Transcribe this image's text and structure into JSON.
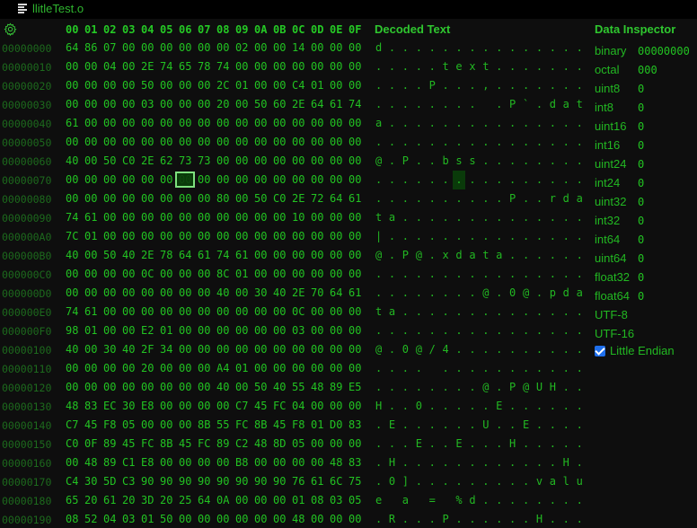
{
  "tab": {
    "title": "llitleTest.o",
    "icon": "hamburger-lines-icon"
  },
  "hex": {
    "column_headers": [
      "00",
      "01",
      "02",
      "03",
      "04",
      "05",
      "06",
      "07",
      "08",
      "09",
      "0A",
      "0B",
      "0C",
      "0D",
      "0E",
      "0F"
    ],
    "selected": {
      "row": 7,
      "col": 6
    },
    "rows": [
      {
        "address": "00000000",
        "bytes": [
          "64",
          "86",
          "07",
          "00",
          "00",
          "00",
          "00",
          "00",
          "00",
          "02",
          "00",
          "00",
          "14",
          "00",
          "00",
          "00"
        ],
        "text": "d..............."
      },
      {
        "address": "00000010",
        "bytes": [
          "00",
          "00",
          "04",
          "00",
          "2E",
          "74",
          "65",
          "78",
          "74",
          "00",
          "00",
          "00",
          "00",
          "00",
          "00",
          "00"
        ],
        "text": ".....text......."
      },
      {
        "address": "00000020",
        "bytes": [
          "00",
          "00",
          "00",
          "00",
          "50",
          "00",
          "00",
          "00",
          "2C",
          "01",
          "00",
          "00",
          "C4",
          "01",
          "00",
          "00"
        ],
        "text": "....P...,......."
      },
      {
        "address": "00000030",
        "bytes": [
          "00",
          "00",
          "00",
          "00",
          "03",
          "00",
          "00",
          "00",
          "20",
          "00",
          "50",
          "60",
          "2E",
          "64",
          "61",
          "74"
        ],
        "text": "........ .P`.dat"
      },
      {
        "address": "00000040",
        "bytes": [
          "61",
          "00",
          "00",
          "00",
          "00",
          "00",
          "00",
          "00",
          "00",
          "00",
          "00",
          "00",
          "00",
          "00",
          "00",
          "00"
        ],
        "text": "a..............."
      },
      {
        "address": "00000050",
        "bytes": [
          "00",
          "00",
          "00",
          "00",
          "00",
          "00",
          "00",
          "00",
          "00",
          "00",
          "00",
          "00",
          "00",
          "00",
          "00",
          "00"
        ],
        "text": "................"
      },
      {
        "address": "00000060",
        "bytes": [
          "40",
          "00",
          "50",
          "C0",
          "2E",
          "62",
          "73",
          "73",
          "00",
          "00",
          "00",
          "00",
          "00",
          "00",
          "00",
          "00"
        ],
        "text": "@.P..bss........"
      },
      {
        "address": "00000070",
        "bytes": [
          "00",
          "00",
          "00",
          "00",
          "00",
          "00",
          "00",
          "00",
          "00",
          "00",
          "00",
          "00",
          "00",
          "00",
          "00",
          "00"
        ],
        "text": "................"
      },
      {
        "address": "00000080",
        "bytes": [
          "00",
          "00",
          "00",
          "00",
          "00",
          "00",
          "00",
          "00",
          "80",
          "00",
          "50",
          "C0",
          "2E",
          "72",
          "64",
          "61"
        ],
        "text": "..........P..rda"
      },
      {
        "address": "00000090",
        "bytes": [
          "74",
          "61",
          "00",
          "00",
          "00",
          "00",
          "00",
          "00",
          "00",
          "00",
          "00",
          "00",
          "10",
          "00",
          "00",
          "00"
        ],
        "text": "ta.............."
      },
      {
        "address": "000000A0",
        "bytes": [
          "7C",
          "01",
          "00",
          "00",
          "00",
          "00",
          "00",
          "00",
          "00",
          "00",
          "00",
          "00",
          "00",
          "00",
          "00",
          "00"
        ],
        "text": "|..............."
      },
      {
        "address": "000000B0",
        "bytes": [
          "40",
          "00",
          "50",
          "40",
          "2E",
          "78",
          "64",
          "61",
          "74",
          "61",
          "00",
          "00",
          "00",
          "00",
          "00",
          "00"
        ],
        "text": "@.P@.xdata......"
      },
      {
        "address": "000000C0",
        "bytes": [
          "00",
          "00",
          "00",
          "00",
          "0C",
          "00",
          "00",
          "00",
          "8C",
          "01",
          "00",
          "00",
          "00",
          "00",
          "00",
          "00"
        ],
        "text": "................"
      },
      {
        "address": "000000D0",
        "bytes": [
          "00",
          "00",
          "00",
          "00",
          "00",
          "00",
          "00",
          "00",
          "40",
          "00",
          "30",
          "40",
          "2E",
          "70",
          "64",
          "61"
        ],
        "text": "........@.0@.pda"
      },
      {
        "address": "000000E0",
        "bytes": [
          "74",
          "61",
          "00",
          "00",
          "00",
          "00",
          "00",
          "00",
          "00",
          "00",
          "00",
          "00",
          "0C",
          "00",
          "00",
          "00"
        ],
        "text": "ta.............."
      },
      {
        "address": "000000F0",
        "bytes": [
          "98",
          "01",
          "00",
          "00",
          "E2",
          "01",
          "00",
          "00",
          "00",
          "00",
          "00",
          "00",
          "03",
          "00",
          "00",
          "00"
        ],
        "text": "................"
      },
      {
        "address": "00000100",
        "bytes": [
          "40",
          "00",
          "30",
          "40",
          "2F",
          "34",
          "00",
          "00",
          "00",
          "00",
          "00",
          "00",
          "00",
          "00",
          "00",
          "00"
        ],
        "text": "@.0@/4.........."
      },
      {
        "address": "00000110",
        "bytes": [
          "00",
          "00",
          "00",
          "00",
          "20",
          "00",
          "00",
          "00",
          "A4",
          "01",
          "00",
          "00",
          "00",
          "00",
          "00",
          "00"
        ],
        "text": ".... ..........."
      },
      {
        "address": "00000120",
        "bytes": [
          "00",
          "00",
          "00",
          "00",
          "00",
          "00",
          "00",
          "00",
          "40",
          "00",
          "50",
          "40",
          "55",
          "48",
          "89",
          "E5"
        ],
        "text": "........@.P@UH.."
      },
      {
        "address": "00000130",
        "bytes": [
          "48",
          "83",
          "EC",
          "30",
          "E8",
          "00",
          "00",
          "00",
          "00",
          "C7",
          "45",
          "FC",
          "04",
          "00",
          "00",
          "00"
        ],
        "text": "H..0.....E......"
      },
      {
        "address": "00000140",
        "bytes": [
          "C7",
          "45",
          "F8",
          "05",
          "00",
          "00",
          "00",
          "8B",
          "55",
          "FC",
          "8B",
          "45",
          "F8",
          "01",
          "D0",
          "83"
        ],
        "text": ".E......U..E...."
      },
      {
        "address": "00000150",
        "bytes": [
          "C0",
          "0F",
          "89",
          "45",
          "FC",
          "8B",
          "45",
          "FC",
          "89",
          "C2",
          "48",
          "8D",
          "05",
          "00",
          "00",
          "00"
        ],
        "text": "...E..E...H....."
      },
      {
        "address": "00000160",
        "bytes": [
          "00",
          "48",
          "89",
          "C1",
          "E8",
          "00",
          "00",
          "00",
          "00",
          "B8",
          "00",
          "00",
          "00",
          "00",
          "48",
          "83"
        ],
        "text": ".H............H."
      },
      {
        "address": "00000170",
        "bytes": [
          "C4",
          "30",
          "5D",
          "C3",
          "90",
          "90",
          "90",
          "90",
          "90",
          "90",
          "90",
          "90",
          "76",
          "61",
          "6C",
          "75"
        ],
        "text": ".0].........valu"
      },
      {
        "address": "00000180",
        "bytes": [
          "65",
          "20",
          "61",
          "20",
          "3D",
          "20",
          "25",
          "64",
          "0A",
          "00",
          "00",
          "00",
          "01",
          "08",
          "03",
          "05"
        ],
        "text": "e a = %d........"
      },
      {
        "address": "00000190",
        "bytes": [
          "08",
          "52",
          "04",
          "03",
          "01",
          "50",
          "00",
          "00",
          "00",
          "00",
          "00",
          "00",
          "48",
          "00",
          "00",
          "00"
        ],
        "text": ".R...P......H..."
      }
    ]
  },
  "decoded": {
    "title": "Decoded Text"
  },
  "inspector": {
    "title": "Data Inspector",
    "fields": [
      {
        "label": "binary",
        "value": "00000000"
      },
      {
        "label": "octal",
        "value": "000"
      },
      {
        "label": "uint8",
        "value": "0"
      },
      {
        "label": "int8",
        "value": "0"
      },
      {
        "label": "uint16",
        "value": "0"
      },
      {
        "label": "int16",
        "value": "0"
      },
      {
        "label": "uint24",
        "value": "0"
      },
      {
        "label": "int24",
        "value": "0"
      },
      {
        "label": "uint32",
        "value": "0"
      },
      {
        "label": "int32",
        "value": "0"
      },
      {
        "label": "int64",
        "value": "0"
      },
      {
        "label": "uint64",
        "value": "0"
      },
      {
        "label": "float32",
        "value": "0"
      },
      {
        "label": "float64",
        "value": "0"
      },
      {
        "label": "UTF-8",
        "value": ""
      },
      {
        "label": "UTF-16",
        "value": ""
      }
    ],
    "little_endian": {
      "label": "Little Endian",
      "checked": true
    }
  },
  "colors": {
    "accent": "#22c322",
    "address": "#1d6a1d",
    "selection_outline": "#7ee07e",
    "checkbox": "#1f6feb"
  }
}
